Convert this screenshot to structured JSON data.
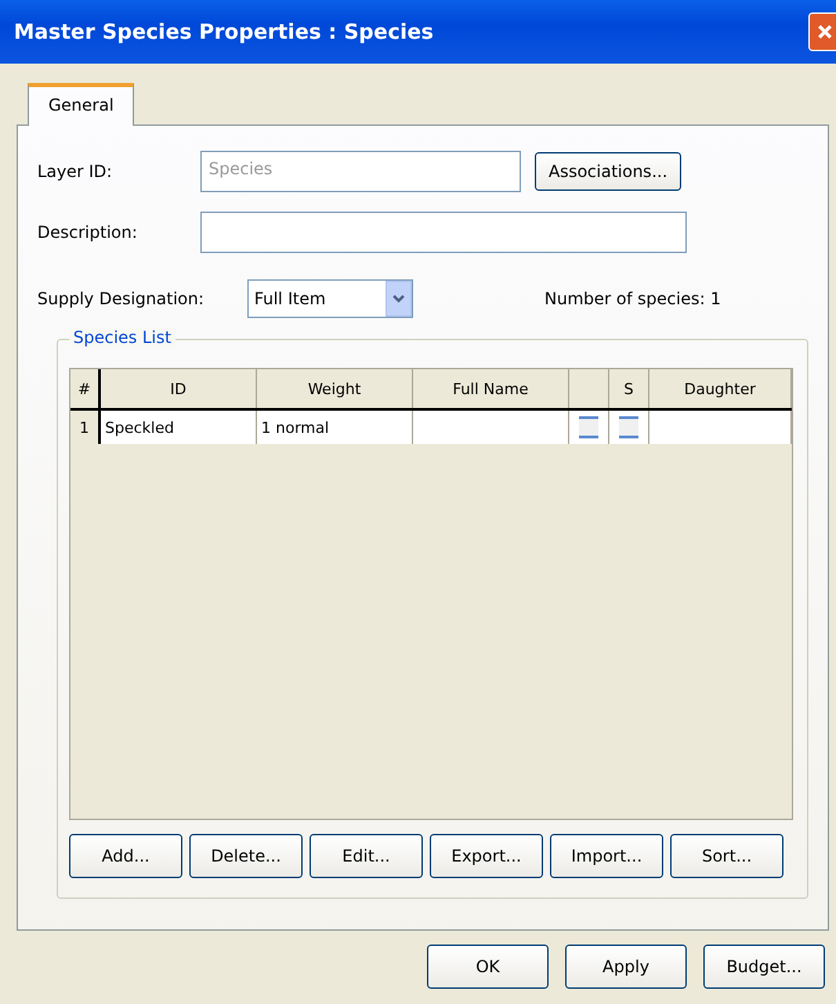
{
  "window": {
    "title": "Master Species Properties : Species"
  },
  "tabs": [
    {
      "label": "General",
      "selected": true
    }
  ],
  "fields": [
    {
      "label": "Layer ID:",
      "value": "Species",
      "disabled": true,
      "button": "Associations..."
    },
    {
      "label": "Description:"
    }
  ],
  "supply": {
    "label": "Supply Designation:",
    "value": "Full Item",
    "count": "Number of species: 1"
  },
  "group": {
    "title": "Species List"
  },
  "table": {
    "columns": [
      "#",
      "ID",
      "Weight",
      "Full Name",
      "",
      "S",
      "Daughter"
    ],
    "rows": [
      {
        "cells": [
          {
            "kind": "text",
            "text": "1"
          },
          {
            "kind": "text",
            "text": "Speckled"
          },
          {
            "kind": "text",
            "text": "1 normal"
          },
          {
            "kind": "text",
            "text": ""
          },
          {
            "kind": "checkbox",
            "checked": false
          },
          {
            "kind": "checkbox",
            "checked": false
          },
          {
            "kind": "text",
            "text": ""
          }
        ]
      }
    ]
  },
  "list_buttons": [
    "Add...",
    "Delete...",
    "Edit...",
    "Export...",
    "Import...",
    "Sort..."
  ],
  "buttons": [
    "OK",
    "Apply",
    "Budget..."
  ]
}
